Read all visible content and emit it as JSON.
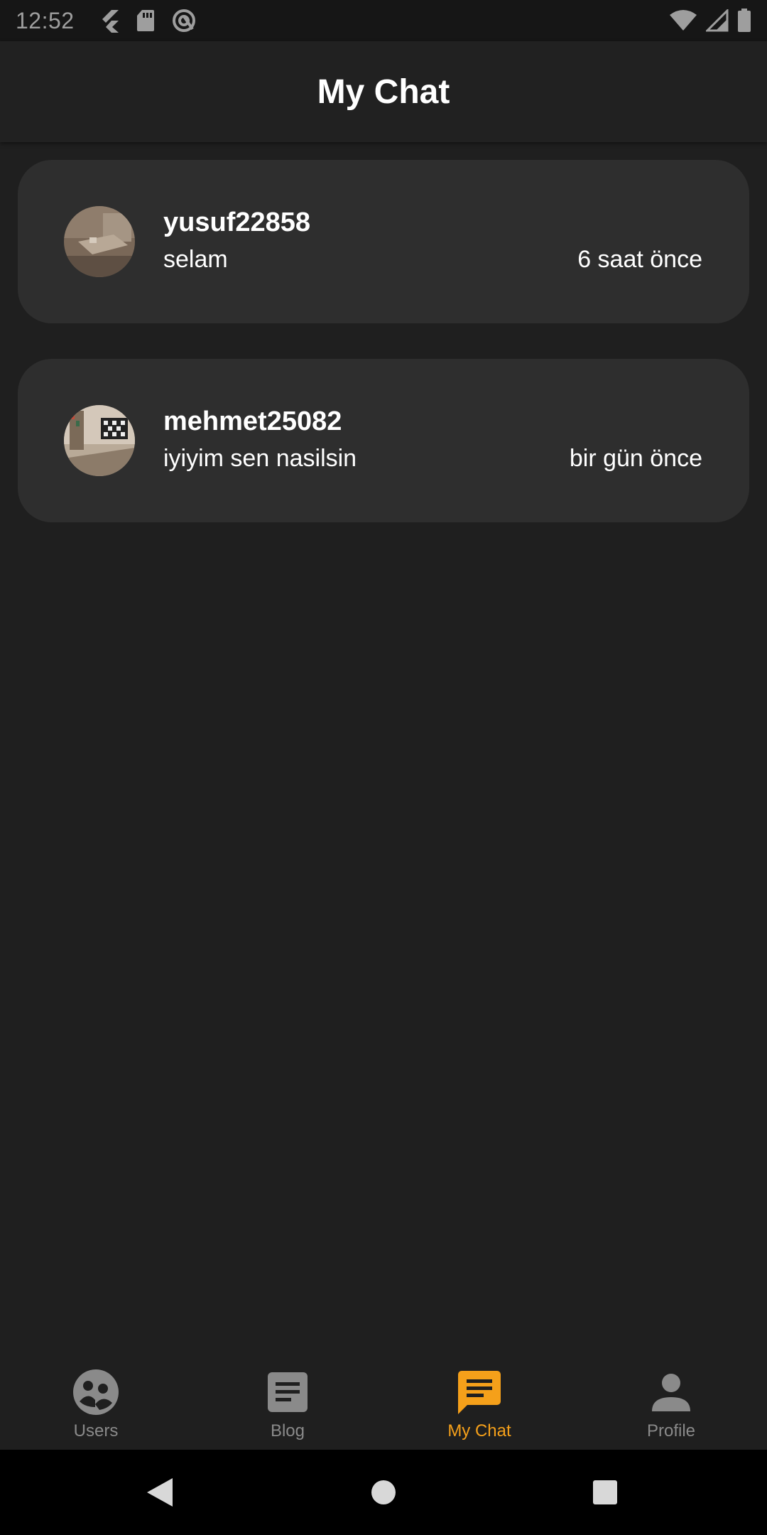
{
  "status_bar": {
    "time": "12:52",
    "left_icons": [
      "flutter-icon",
      "sd-card-icon",
      "sync-icon"
    ],
    "right_icons": [
      "wifi-icon",
      "cell-signal-icon",
      "battery-icon"
    ]
  },
  "app_bar": {
    "title": "My Chat"
  },
  "chats": [
    {
      "username": "yusuf22858",
      "last_message": "selam",
      "time": "6 saat önce"
    },
    {
      "username": "mehmet25082",
      "last_message": "iyiyim sen nasilsin",
      "time": "bir gün önce"
    }
  ],
  "bottom_nav": {
    "active_index": 2,
    "accent_color": "#f5a01a",
    "items": [
      {
        "label": "Users",
        "icon": "users-icon"
      },
      {
        "label": "Blog",
        "icon": "article-icon"
      },
      {
        "label": "My Chat",
        "icon": "chat-icon"
      },
      {
        "label": "Profile",
        "icon": "person-icon"
      }
    ]
  },
  "system_nav": {
    "buttons": [
      "back-icon",
      "home-icon",
      "recents-icon"
    ]
  }
}
